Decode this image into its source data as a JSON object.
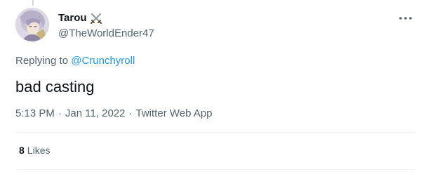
{
  "tweet": {
    "author": {
      "display_name": "Tarou",
      "badge_icon": "crossed-swords-icon",
      "handle": "@TheWorldEnder47"
    },
    "reply": {
      "prefix": "Replying to ",
      "mention": "@Crunchyroll"
    },
    "text": "bad casting",
    "meta": {
      "time": "5:13 PM",
      "separator": "·",
      "date": "Jan 11, 2022",
      "source": "Twitter Web App"
    },
    "stats": {
      "likes_count": "8",
      "likes_label": "Likes"
    }
  },
  "colors": {
    "text_primary": "#0f1419",
    "text_secondary": "#536471",
    "link": "#1d9bf0",
    "divider": "#eff3f4"
  }
}
